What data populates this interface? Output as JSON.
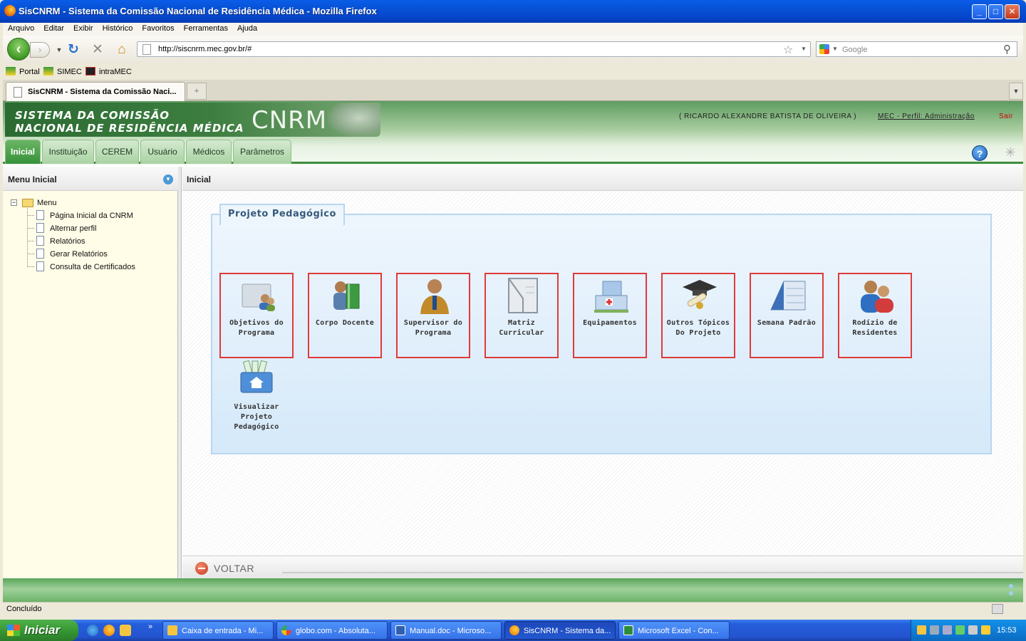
{
  "window": {
    "title": "SisCNRM - Sistema da Comissão Nacional de Residência Médica - Mozilla Firefox"
  },
  "menubar": [
    "Arquivo",
    "Editar",
    "Exibir",
    "Histórico",
    "Favoritos",
    "Ferramentas",
    "Ajuda"
  ],
  "navbar": {
    "url": "http://siscnrm.mec.gov.br/#",
    "search_placeholder": "Google"
  },
  "bookmarks": [
    "Portal",
    "SIMEC",
    "intraMEC"
  ],
  "browser_tab": {
    "title": "SisCNRM - Sistema da Comissão Naci..."
  },
  "app": {
    "logo_line1": "SISTEMA DA COMISSÃO",
    "logo_line2": "NACIONAL DE RESIDÊNCIA MÉDICA",
    "logo_big": "CNRM",
    "user": "( RICARDO ALEXANDRE BATISTA DE OLIVEIRA )",
    "perfil": "MEC - Perfil: Administração",
    "logout": "Sair",
    "tabs": [
      "Inicial",
      "Instituição",
      "CEREM",
      "Usuário",
      "Médicos",
      "Parâmetros"
    ],
    "active_tab": "Inicial",
    "help": "?"
  },
  "left_panel": {
    "title": "Menu Inicial",
    "root": "Menu",
    "items": [
      "Página Inicial da CNRM",
      "Alternar perfil",
      "Relatórios",
      "Gerar Relatórios",
      "Consulta de Certificados"
    ]
  },
  "content": {
    "title": "Inicial",
    "legend": "Projeto Pedagógico",
    "tiles": [
      {
        "line1": "Objetivos do",
        "line2": "Programa",
        "icon": "folder-users-icon"
      },
      {
        "line1": "Corpo Docente",
        "line2": "",
        "icon": "teacher-book-icon"
      },
      {
        "line1": "Supervisor do",
        "line2": "Programa",
        "icon": "supervisor-icon"
      },
      {
        "line1": "Matriz",
        "line2": "Curricular",
        "icon": "notebook-icon"
      },
      {
        "line1": "Equipamentos",
        "line2": "",
        "icon": "hospital-building-icon"
      },
      {
        "line1": "Outros Tópicos",
        "line2": "Do Projeto",
        "icon": "graduation-cap-icon"
      },
      {
        "line1": "Semana Padrão",
        "line2": "",
        "icon": "calendar-icon"
      },
      {
        "line1": "Rodízio de",
        "line2": "Residentes",
        "icon": "residents-icon"
      }
    ],
    "extra_tile": {
      "line1": "Visualizar",
      "line2": "Projeto",
      "line3": "Pedagógico",
      "icon": "home-box-icon"
    },
    "back_button": "VOLTAR"
  },
  "status": "Concluído",
  "taskbar": {
    "start": "Iniciar",
    "tasks": [
      "Caixa de entrada - Mi...",
      "globo.com - Absoluta...",
      "Manual.doc - Microso...",
      "SisCNRM - Sistema da...",
      "Microsoft Excel - Con..."
    ],
    "active_task": "SisCNRM - Sistema da...",
    "clock": "15:53"
  }
}
